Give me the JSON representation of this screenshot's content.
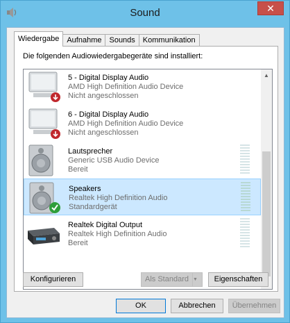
{
  "window": {
    "title": "Sound",
    "close_glyph": "✕"
  },
  "tabs": [
    {
      "label": "Wiedergabe",
      "active": true
    },
    {
      "label": "Aufnahme",
      "active": false
    },
    {
      "label": "Sounds",
      "active": false
    },
    {
      "label": "Kommunikation",
      "active": false
    }
  ],
  "intro": "Die folgenden Audiowiedergabegeräte sind installiert:",
  "devices": [
    {
      "name": "5 - Digital Display Audio",
      "description": "AMD High Definition Audio Device",
      "status": "Nicht angeschlossen",
      "icon": "monitor-icon",
      "badge": "red-down-arrow-icon",
      "selected": false
    },
    {
      "name": "6 - Digital Display Audio",
      "description": "AMD High Definition Audio Device",
      "status": "Nicht angeschlossen",
      "icon": "monitor-icon",
      "badge": "red-down-arrow-icon",
      "selected": false
    },
    {
      "name": "Lautsprecher",
      "description": "Generic USB Audio Device",
      "status": "Bereit",
      "icon": "speaker-icon",
      "badge": "",
      "selected": false
    },
    {
      "name": "Speakers",
      "description": "Realtek High Definition Audio",
      "status": "Standardgerät",
      "icon": "speaker-icon",
      "badge": "green-check-icon",
      "selected": true
    },
    {
      "name": "Realtek Digital Output",
      "description": "Realtek High Definition Audio",
      "status": "Bereit",
      "icon": "receiver-icon",
      "badge": "",
      "selected": false
    }
  ],
  "buttons": {
    "configure": "Konfigurieren",
    "set_default": "Als Standard",
    "properties": "Eigenschaften",
    "ok": "OK",
    "cancel": "Abbrechen",
    "apply": "Übernehmen"
  },
  "colors": {
    "titlebar": "#6ec1e8",
    "selection": "#cce8ff",
    "close": "#c7504a"
  }
}
